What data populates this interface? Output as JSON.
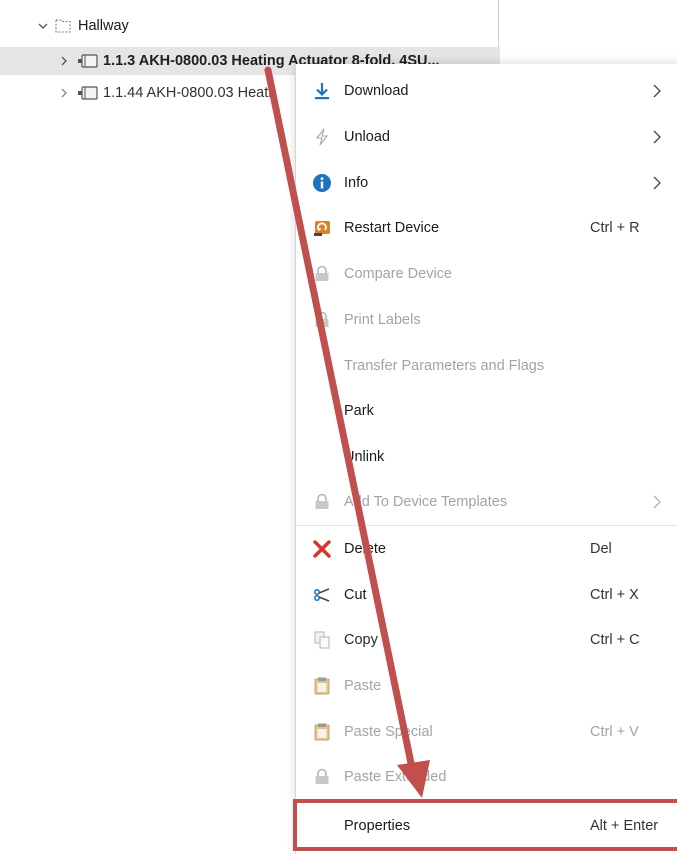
{
  "tree": {
    "hallway_label": "Hallway",
    "device1_label": "1.1.3 AKH-0800.03 Heating Actuator 8-fold, 4SU...",
    "device2_label": "1.1.44 AKH-0800.03 Heati"
  },
  "menu": {
    "download": "Download",
    "unload": "Unload",
    "info": "Info",
    "restart": "Restart Device",
    "restart_shortcut": "Ctrl + R",
    "compare": "Compare Device",
    "print_labels": "Print Labels",
    "transfer": "Transfer Parameters and Flags",
    "park": "Park",
    "unlink": "Unlink",
    "add_templates": "Add To Device Templates",
    "delete": "Delete",
    "delete_shortcut": "Del",
    "cut": "Cut",
    "cut_shortcut": "Ctrl + X",
    "copy": "Copy",
    "copy_shortcut": "Ctrl + C",
    "paste": "Paste",
    "paste_special": "Paste Special",
    "paste_special_shortcut": "Ctrl + V",
    "paste_extended": "Paste Extended",
    "properties": "Properties",
    "properties_shortcut": "Alt + Enter"
  },
  "colors": {
    "annotation": "#c0504d",
    "download_icon": "#1e73be",
    "info_icon": "#1e73be",
    "restart_icon": "#d9822b",
    "delete_icon": "#d9342b"
  },
  "icons": {
    "folder": "folder-outline-icon",
    "device": "device-icon",
    "download": "download-icon",
    "unload": "unload-icon",
    "info": "info-icon",
    "restart": "restart-icon",
    "lock": "lock-icon",
    "delete": "delete-icon",
    "cut": "scissors-icon",
    "copy": "copy-icon",
    "paste": "clipboard-icon"
  }
}
